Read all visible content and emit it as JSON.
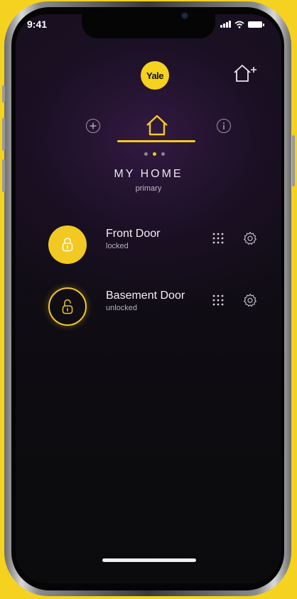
{
  "status_bar": {
    "time": "9:41"
  },
  "brand": {
    "logo_text": "Yale",
    "accent_color": "#f2c922"
  },
  "header": {
    "add_home_icon": "house-plus-icon",
    "add_icon": "plus-circle-icon",
    "home_icon": "house-icon",
    "info_icon": "info-circle-icon"
  },
  "home": {
    "name": "MY HOME",
    "role": "primary",
    "page_count": 3,
    "active_page": 2
  },
  "locks": [
    {
      "name": "Front Door",
      "status": "locked",
      "icon": "padlock-closed-icon"
    },
    {
      "name": "Basement Door",
      "status": "unlocked",
      "icon": "padlock-open-icon"
    }
  ]
}
